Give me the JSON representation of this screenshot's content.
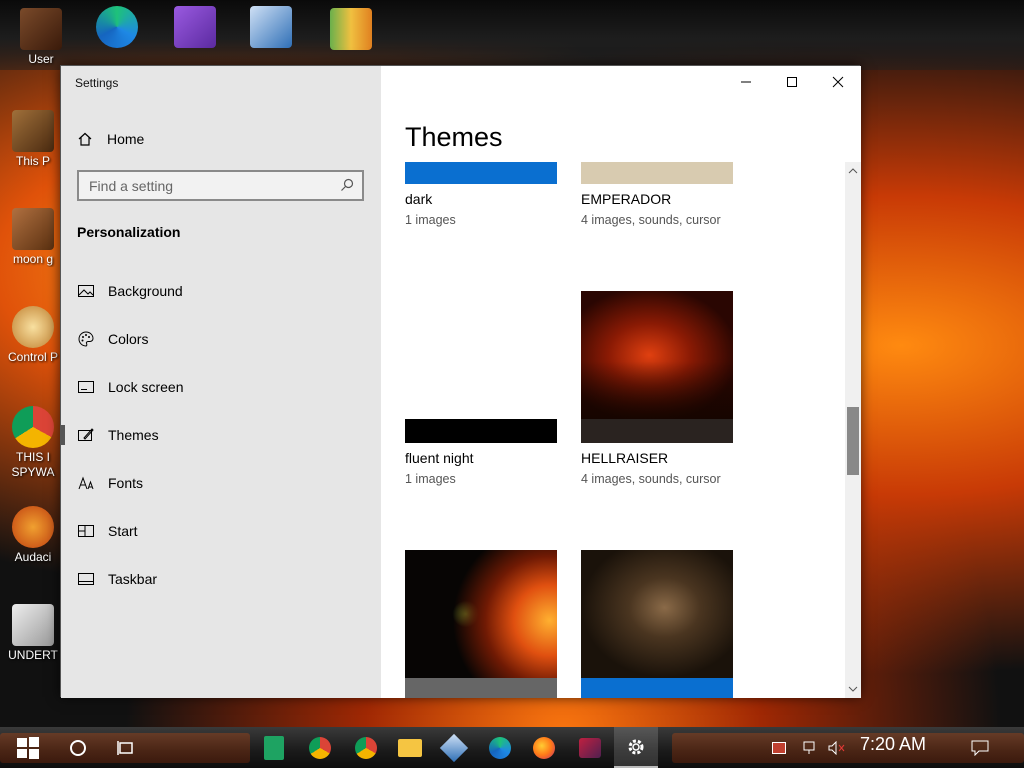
{
  "desktop": {
    "icons_top": [
      {
        "label": "User",
        "icon": "user-folder-icon",
        "color": "#6b3a1a"
      },
      {
        "label": "Edge",
        "icon": "edge-icon",
        "color": "#1e88e5"
      },
      {
        "label": "VS",
        "icon": "visual-studio-icon",
        "color": "#7b3fc4"
      },
      {
        "label": "VirtualBox",
        "icon": "virtualbox-icon",
        "color": "#2f6fb6"
      },
      {
        "label": "HxD",
        "icon": "hxd-icon",
        "color": "#e8c050"
      }
    ],
    "icons_left": [
      {
        "label": "This P",
        "icon": "this-pc-icon",
        "color": "#8b5a2b"
      },
      {
        "label": "moon g",
        "icon": "moon-game-icon",
        "color": "#a0602a"
      },
      {
        "label": "Control P",
        "icon": "control-panel-icon",
        "color": "#c8a040"
      },
      {
        "label": "THIS I SPYWA",
        "icon": "chrome-icon",
        "color": "#db4437"
      },
      {
        "label": "Audaci",
        "icon": "audacity-icon",
        "color": "#e08020"
      },
      {
        "label": "UNDERT",
        "icon": "unity-icon",
        "color": "#111111"
      }
    ]
  },
  "window": {
    "title": "Settings",
    "controls": {
      "minimize": "minimize-icon",
      "maximize": "maximize-icon",
      "close": "close-icon"
    }
  },
  "sidebar": {
    "home_label": "Home",
    "search_placeholder": "Find a setting",
    "section_title": "Personalization",
    "items": [
      {
        "label": "Background",
        "icon": "picture-icon"
      },
      {
        "label": "Colors",
        "icon": "palette-icon"
      },
      {
        "label": "Lock screen",
        "icon": "lock-screen-icon"
      },
      {
        "label": "Themes",
        "icon": "brush-icon",
        "selected": true
      },
      {
        "label": "Fonts",
        "icon": "font-icon"
      },
      {
        "label": "Start",
        "icon": "start-icon"
      },
      {
        "label": "Taskbar",
        "icon": "taskbar-icon"
      }
    ]
  },
  "content": {
    "title": "Themes",
    "themes": [
      {
        "name": "dark",
        "desc": "1 images",
        "accent": "#0a6fd0"
      },
      {
        "name": "EMPERADOR",
        "desc": "4 images, sounds, cursor",
        "accent": "#d8cbb0"
      },
      {
        "name": "fluent night",
        "desc": "1 images",
        "accent": "#000000"
      },
      {
        "name": "HELLRAISER",
        "desc": "4 images, sounds, cursor",
        "accent": "#3a2a20"
      },
      {
        "name": "",
        "desc": "",
        "accent": "#666666"
      },
      {
        "name": "",
        "desc": "",
        "accent": "#0a6fd0"
      }
    ]
  },
  "taskbar": {
    "clock": "7:20 AM",
    "apps": [
      "start-icon",
      "cortana-icon",
      "task-view-icon",
      "sheets-icon",
      "chrome-icon",
      "chrome-icon",
      "file-explorer-icon",
      "virtualbox-icon",
      "edge-icon",
      "firefox-icon",
      "app-icon",
      "settings-gear-icon"
    ],
    "tray": [
      "tray-app-icon",
      "network-icon",
      "volume-muted-icon",
      "notification-icon"
    ]
  }
}
